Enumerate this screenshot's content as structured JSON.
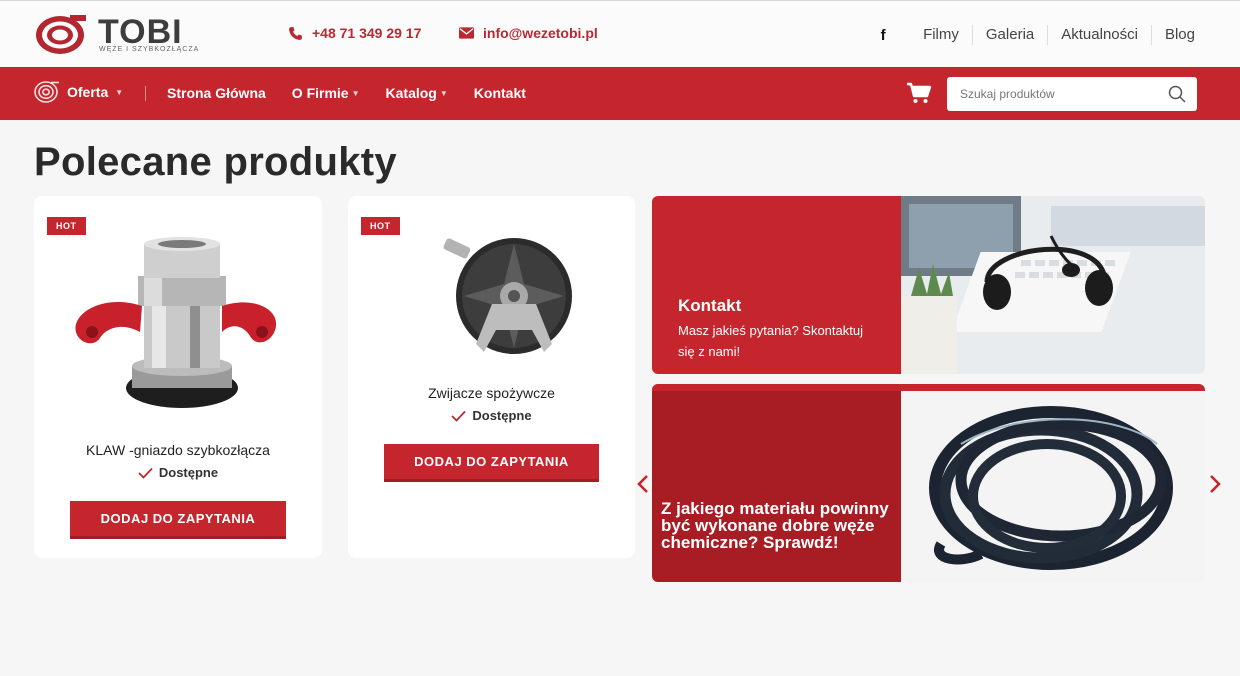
{
  "brand": {
    "name": "TOBI",
    "tagline": "WĘŻE I SZYBKOZŁĄCZA",
    "color": "#c5262e"
  },
  "topbar": {
    "phone": "+48 71 349 29 17",
    "email": "info@wezetobi.pl",
    "social_icon": "facebook-icon",
    "links": [
      "Filmy",
      "Galeria",
      "Aktualności",
      "Blog"
    ]
  },
  "nav": {
    "oferta": "Oferta",
    "items": [
      {
        "label": "Strona Główna",
        "dropdown": false
      },
      {
        "label": "O Firmie",
        "dropdown": true
      },
      {
        "label": "Katalog",
        "dropdown": true
      },
      {
        "label": "Kontakt",
        "dropdown": false
      }
    ],
    "search_placeholder": "Szukaj produktów"
  },
  "page_title": "Polecane produkty",
  "products": [
    {
      "badge": "HOT",
      "name": "KLAW -gniazdo szybkozłącza",
      "status": "Dostępne",
      "button": "DODAJ DO ZAPYTANIA"
    },
    {
      "badge": "HOT",
      "name": "Zwijacze spożywcze",
      "status": "Dostępne",
      "button": "DODAJ DO ZAPYTANIA"
    }
  ],
  "promos": [
    {
      "title": "Kontakt",
      "text": "Masz jakieś pytania? Skontaktuj się z nami!"
    },
    {
      "title": "Z jakiego materiału powinny być wykonane dobre węże chemiczne? Sprawdź!"
    }
  ]
}
